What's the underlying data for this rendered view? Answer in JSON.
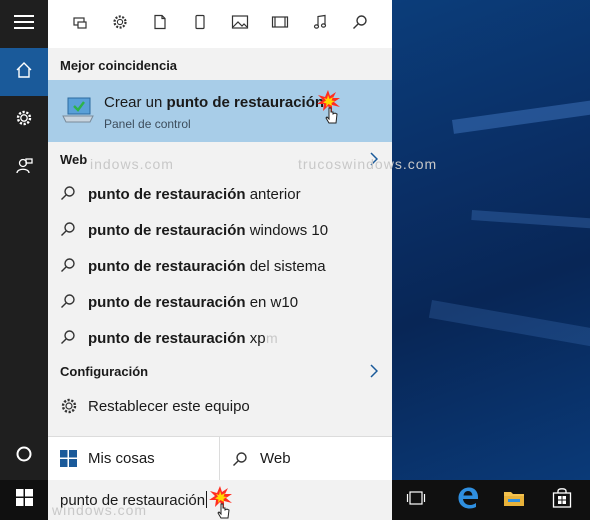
{
  "filter_bar": {
    "icons": [
      "apps-icon",
      "settings-icon",
      "documents-icon",
      "phone-icon",
      "photos-icon",
      "videos-icon",
      "music-icon",
      "search-icon"
    ]
  },
  "sidebar": {
    "icons": [
      "menu-icon",
      "home-icon",
      "settings-icon",
      "feedback-icon",
      "cortana-icon"
    ]
  },
  "best_match": {
    "header": "Mejor coincidencia",
    "title_prefix": "Crear un ",
    "title_bold": "punto de restauración",
    "subtitle": "Panel de control"
  },
  "web": {
    "header": "Web",
    "suggestions": [
      {
        "bold": "punto de restauración",
        "rest": " anterior"
      },
      {
        "bold": "punto de restauración",
        "rest": " windows 10"
      },
      {
        "bold": "punto de restauración",
        "rest": " del sistema"
      },
      {
        "bold": "punto de restauración",
        "rest": " en w10"
      },
      {
        "bold": "punto de restauración",
        "rest": " xp"
      }
    ]
  },
  "config": {
    "header": "Configuración",
    "item": "Restablecer este equipo"
  },
  "bottom_tabs": {
    "mis_cosas": "Mis cosas",
    "web": "Web"
  },
  "taskbar": {
    "search_text": "punto de restauración",
    "icons": [
      "windows-start-icon",
      "task-view-icon",
      "edge-icon",
      "file-explorer-icon",
      "store-icon"
    ]
  },
  "watermark": "trucoswindows.com",
  "colors": {
    "accent": "#1a5a9a",
    "highlight": "#a8cde8",
    "panel": "#f2f2f2",
    "taskbar": "#101010"
  }
}
